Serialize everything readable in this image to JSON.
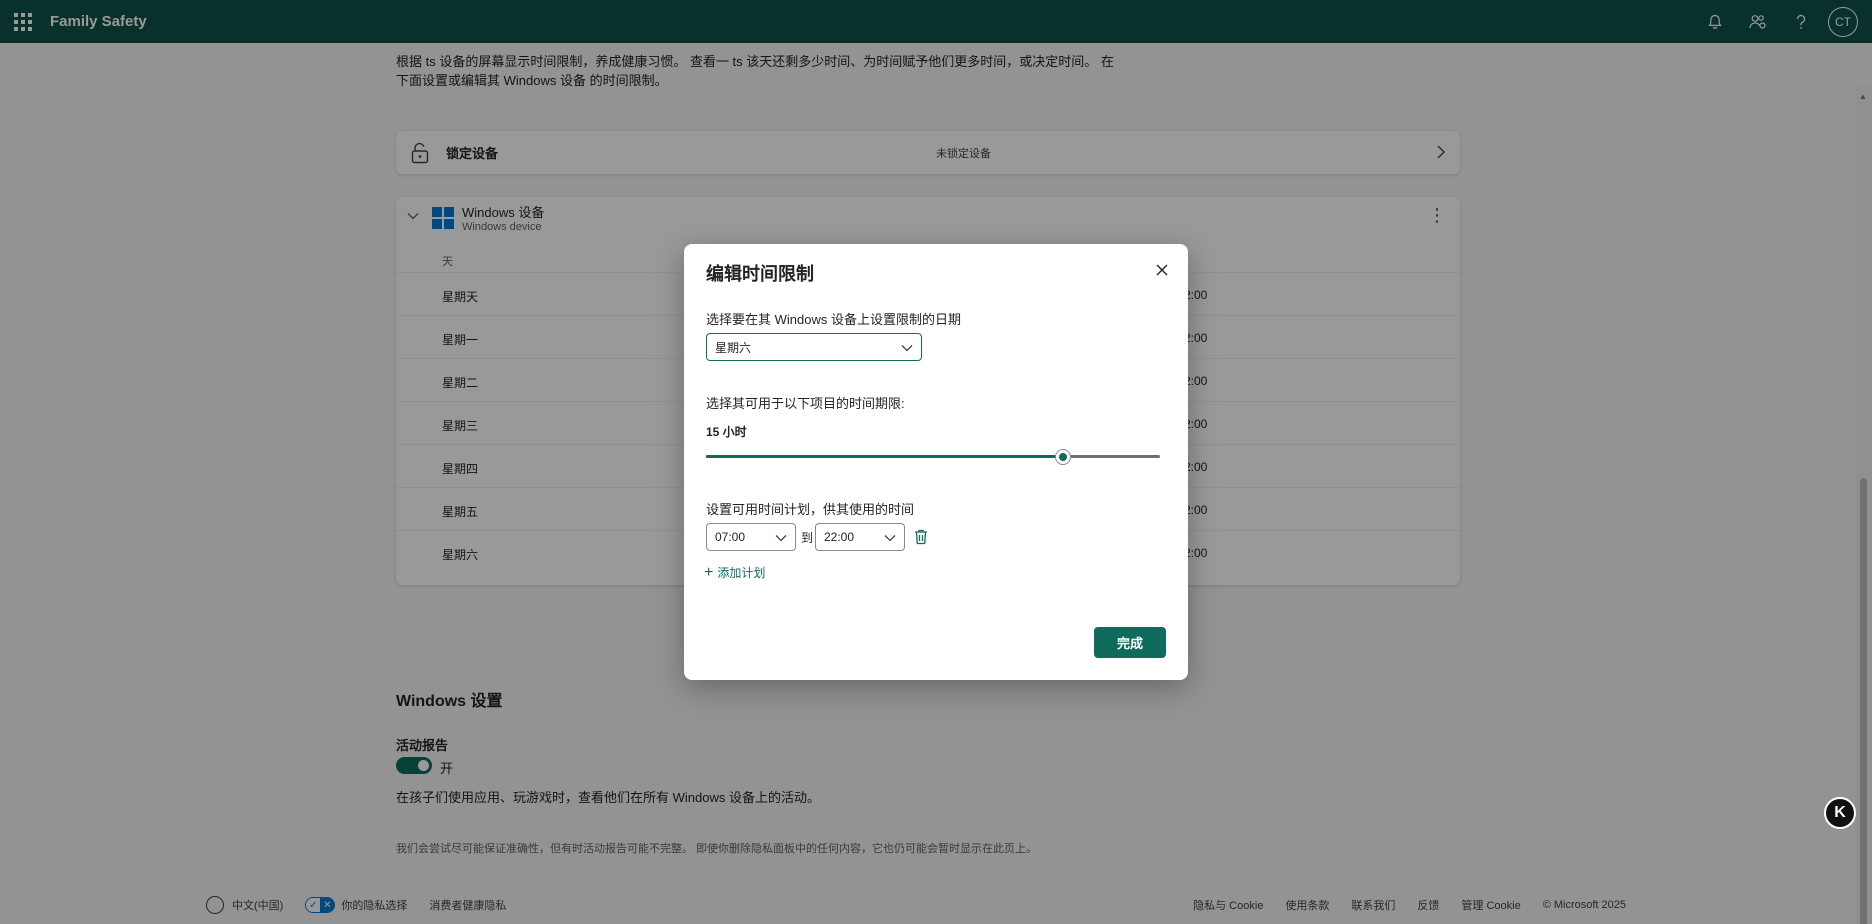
{
  "app": {
    "title": "Family Safety",
    "avatar_initials": "CT"
  },
  "topbar_icons": [
    "bell-icon",
    "people-settings-icon",
    "help-icon"
  ],
  "intro": {
    "line1": "根据 ts 设备的屏幕显示时间限制，养成健康习惯。 查看一 ts 该天还剩多少时间、为时间赋予他们更多时间，或决定时间。 在",
    "line2": "下面设置或编辑其 Windows 设备 的时间限制。"
  },
  "lock_card": {
    "title": "锁定设备",
    "status": "未锁定设备"
  },
  "windows_card": {
    "title": "Windows 设备",
    "subtitle": "Windows device",
    "column_day": "天",
    "rows": [
      {
        "day": "星期天",
        "time": "2:00"
      },
      {
        "day": "星期一",
        "time": "2:00"
      },
      {
        "day": "星期二",
        "time": "2:00"
      },
      {
        "day": "星期三",
        "time": "2:00"
      },
      {
        "day": "星期四",
        "time": "2:00"
      },
      {
        "day": "星期五",
        "time": "2:00"
      },
      {
        "day": "星期六",
        "time": "2:00"
      }
    ]
  },
  "settings": {
    "title": "Windows 设置",
    "activity_label": "活动报告",
    "toggle_state": "开",
    "activity_desc": "在孩子们使用应用、玩游戏时，查看他们在所有 Windows 设备上的活动。",
    "disclaimer": "我们会尝试尽可能保证准确性，但有时活动报告可能不完整。 即使你删除隐私面板中的任何内容，它也仍可能会暂时显示在此页上。"
  },
  "footer": {
    "language": "中文(中国)",
    "privacy_choices": "你的隐私选择",
    "consumer_health": "消费者健康隐私",
    "links": [
      "隐私与 Cookie",
      "使用条款",
      "联系我们",
      "反馈",
      "管理 Cookie",
      "© Microsoft 2025"
    ]
  },
  "dialog": {
    "title": "编辑时间限制",
    "day_label": "选择要在其 Windows 设备上设置限制的日期",
    "selected_day": "星期六",
    "limit_label": "选择其可用于以下项目的时间期限:",
    "hours_text": "15 小时",
    "slider_fraction": 0.787,
    "schedule_label": "设置可用时间计划，供其使用的时间",
    "from_time": "07:00",
    "to_word": "到",
    "to_time": "22:00",
    "add_plan": "添加计划",
    "done": "完成"
  },
  "floating_badge": "K",
  "colors": {
    "brand": "#0f5348",
    "accent": "#0f6c5c"
  }
}
